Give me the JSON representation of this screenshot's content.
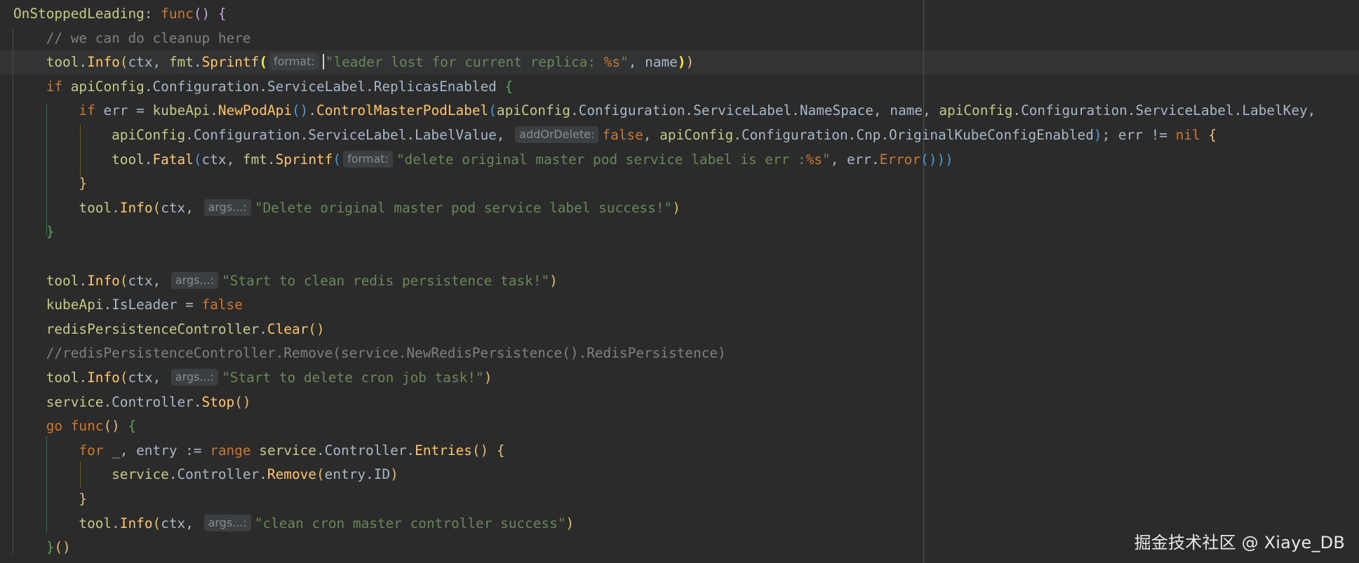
{
  "editor": {
    "lines": [
      {
        "id": "l1",
        "tokens": [
          {
            "t": "OnStoppedLeading",
            "c": "idf"
          },
          {
            "t": ": "
          },
          {
            "t": "func",
            "c": "kw"
          },
          {
            "t": "()",
            "c": "bp"
          },
          {
            "t": " "
          },
          {
            "t": "{",
            "c": "bp"
          }
        ]
      },
      {
        "id": "l2",
        "tokens": [
          {
            "t": "    "
          },
          {
            "t": "// we can do cleanup here",
            "c": "cm"
          }
        ]
      },
      {
        "id": "l3",
        "tokens": [
          {
            "t": "    "
          },
          {
            "t": "tool",
            "c": "idf"
          },
          {
            "t": "."
          },
          {
            "t": "Info",
            "c": "fn"
          },
          {
            "t": "(",
            "c": "bm"
          },
          {
            "t": "ctx, "
          },
          {
            "t": "fmt",
            "c": "idf"
          },
          {
            "t": "."
          },
          {
            "t": "Sprintf",
            "c": "fn"
          },
          {
            "t": "(",
            "c": "bmatch"
          },
          {
            "h": "format:"
          },
          {
            "caret": true
          },
          {
            "t": "\"leader lost for current replica: ",
            "c": "str"
          },
          {
            "t": "%s",
            "c": "fmt"
          },
          {
            "t": "\"",
            "c": "str"
          },
          {
            "t": ", name"
          },
          {
            "t": ")",
            "c": "bmatch"
          },
          {
            "t": ")",
            "c": "bm"
          }
        ]
      },
      {
        "id": "l4",
        "tokens": [
          {
            "t": "    "
          },
          {
            "t": "if",
            "c": "kw"
          },
          {
            "t": " "
          },
          {
            "t": "apiConfig",
            "c": "idf"
          },
          {
            "t": ".Configuration.ServiceLabel.ReplicasEnabled "
          },
          {
            "t": "{",
            "c": "bg"
          }
        ]
      },
      {
        "id": "l5",
        "tokens": [
          {
            "t": "        "
          },
          {
            "t": "if",
            "c": "kw"
          },
          {
            "t": " err = "
          },
          {
            "t": "kubeApi",
            "c": "idf"
          },
          {
            "t": "."
          },
          {
            "t": "NewPodApi",
            "c": "fn"
          },
          {
            "t": "()",
            "c": "bb"
          },
          {
            "t": "."
          },
          {
            "t": "ControlMasterPodLabel",
            "c": "fn"
          },
          {
            "t": "(",
            "c": "bb"
          },
          {
            "t": "apiConfig",
            "c": "idf"
          },
          {
            "t": ".Configuration.ServiceLabel.NameSpace, name, "
          },
          {
            "t": "apiConfig",
            "c": "idf"
          },
          {
            "t": ".Configuration.ServiceLabel.LabelKey,"
          }
        ]
      },
      {
        "id": "l6",
        "tokens": [
          {
            "t": "            "
          },
          {
            "t": "apiConfig",
            "c": "idf"
          },
          {
            "t": ".Configuration.ServiceLabel.LabelValue, "
          },
          {
            "h": "addOrDelete:"
          },
          {
            "t": "false",
            "c": "kw"
          },
          {
            "t": ", "
          },
          {
            "t": "apiConfig",
            "c": "idf"
          },
          {
            "t": ".Configuration.Cnp.OriginalKubeConfigEnabled"
          },
          {
            "t": ")",
            "c": "bb"
          },
          {
            "t": "; err != "
          },
          {
            "t": "nil",
            "c": "kw"
          },
          {
            "t": " "
          },
          {
            "t": "{",
            "c": "by"
          }
        ]
      },
      {
        "id": "l7",
        "tokens": [
          {
            "t": "            "
          },
          {
            "t": "tool",
            "c": "idf"
          },
          {
            "t": "."
          },
          {
            "t": "Fatal",
            "c": "fn"
          },
          {
            "t": "(",
            "c": "bb"
          },
          {
            "t": "ctx, "
          },
          {
            "t": "fmt",
            "c": "idf"
          },
          {
            "t": "."
          },
          {
            "t": "Sprintf",
            "c": "fn"
          },
          {
            "t": "(",
            "c": "bb"
          },
          {
            "h": "format:"
          },
          {
            "t": "\"delete original master pod service label is err :",
            "c": "str"
          },
          {
            "t": "%s",
            "c": "fmt"
          },
          {
            "t": "\"",
            "c": "str"
          },
          {
            "t": ", err."
          },
          {
            "t": "Error",
            "c": "kw"
          },
          {
            "t": "()))",
            "c": "bb"
          }
        ]
      },
      {
        "id": "l8",
        "tokens": [
          {
            "t": "        "
          },
          {
            "t": "}",
            "c": "by"
          }
        ]
      },
      {
        "id": "l9",
        "tokens": [
          {
            "t": "        "
          },
          {
            "t": "tool",
            "c": "idf"
          },
          {
            "t": "."
          },
          {
            "t": "Info",
            "c": "fn"
          },
          {
            "t": "(",
            "c": "bm"
          },
          {
            "t": "ctx, "
          },
          {
            "h": "args...:"
          },
          {
            "t": "\"Delete original master pod service label success!\"",
            "c": "str"
          },
          {
            "t": ")",
            "c": "bm"
          }
        ]
      },
      {
        "id": "l10",
        "tokens": [
          {
            "t": "    "
          },
          {
            "t": "}",
            "c": "bg"
          }
        ]
      },
      {
        "id": "l11",
        "tokens": [
          {
            "t": ""
          }
        ]
      },
      {
        "id": "l12",
        "tokens": [
          {
            "t": "    "
          },
          {
            "t": "tool",
            "c": "idf"
          },
          {
            "t": "."
          },
          {
            "t": "Info",
            "c": "fn"
          },
          {
            "t": "(",
            "c": "bm"
          },
          {
            "t": "ctx, "
          },
          {
            "h": "args...:"
          },
          {
            "t": "\"Start to clean redis persistence task!\"",
            "c": "str"
          },
          {
            "t": ")",
            "c": "bm"
          }
        ]
      },
      {
        "id": "l13",
        "tokens": [
          {
            "t": "    "
          },
          {
            "t": "kubeApi",
            "c": "idf"
          },
          {
            "t": ".IsLeader = "
          },
          {
            "t": "false",
            "c": "kw"
          }
        ]
      },
      {
        "id": "l14",
        "tokens": [
          {
            "t": "    "
          },
          {
            "t": "redisPersistenceController",
            "c": "idf"
          },
          {
            "t": "."
          },
          {
            "t": "Clear",
            "c": "fn"
          },
          {
            "t": "()",
            "c": "bm"
          }
        ]
      },
      {
        "id": "l15",
        "tokens": [
          {
            "t": "    "
          },
          {
            "t": "//redisPersistenceController.Remove(service.NewRedisPersistence().RedisPersistence)",
            "c": "cm"
          }
        ]
      },
      {
        "id": "l16",
        "tokens": [
          {
            "t": "    "
          },
          {
            "t": "tool",
            "c": "idf"
          },
          {
            "t": "."
          },
          {
            "t": "Info",
            "c": "fn"
          },
          {
            "t": "(",
            "c": "bm"
          },
          {
            "t": "ctx, "
          },
          {
            "h": "args...:"
          },
          {
            "t": "\"Start to delete cron job task!\"",
            "c": "str"
          },
          {
            "t": ")",
            "c": "bm"
          }
        ]
      },
      {
        "id": "l17",
        "tokens": [
          {
            "t": "    "
          },
          {
            "t": "service",
            "c": "idf"
          },
          {
            "t": ".Controller."
          },
          {
            "t": "Stop",
            "c": "fn"
          },
          {
            "t": "()",
            "c": "bm"
          }
        ]
      },
      {
        "id": "l18",
        "tokens": [
          {
            "t": "    "
          },
          {
            "t": "go",
            "c": "kw"
          },
          {
            "t": " "
          },
          {
            "t": "func",
            "c": "kw"
          },
          {
            "t": "()",
            "c": "bm"
          },
          {
            "t": " "
          },
          {
            "t": "{",
            "c": "bg"
          }
        ]
      },
      {
        "id": "l19",
        "tokens": [
          {
            "t": "        "
          },
          {
            "t": "for",
            "c": "kw"
          },
          {
            "t": " _, entry := "
          },
          {
            "t": "range",
            "c": "kw"
          },
          {
            "t": " "
          },
          {
            "t": "service",
            "c": "idf"
          },
          {
            "t": ".Controller."
          },
          {
            "t": "Entries",
            "c": "fn"
          },
          {
            "t": "()",
            "c": "bm"
          },
          {
            "t": " "
          },
          {
            "t": "{",
            "c": "by"
          }
        ]
      },
      {
        "id": "l20",
        "tokens": [
          {
            "t": "            "
          },
          {
            "t": "service",
            "c": "idf"
          },
          {
            "t": ".Controller."
          },
          {
            "t": "Remove",
            "c": "fn"
          },
          {
            "t": "(",
            "c": "bm"
          },
          {
            "t": "entry.ID"
          },
          {
            "t": ")",
            "c": "bm"
          }
        ]
      },
      {
        "id": "l21",
        "tokens": [
          {
            "t": "        "
          },
          {
            "t": "}",
            "c": "by"
          }
        ]
      },
      {
        "id": "l22",
        "tokens": [
          {
            "t": "        "
          },
          {
            "t": "tool",
            "c": "idf"
          },
          {
            "t": "."
          },
          {
            "t": "Info",
            "c": "fn"
          },
          {
            "t": "(",
            "c": "bm"
          },
          {
            "t": "ctx, "
          },
          {
            "h": "args...:"
          },
          {
            "t": "\"clean cron master controller success\"",
            "c": "str"
          },
          {
            "t": ")",
            "c": "bm"
          }
        ]
      },
      {
        "id": "l23",
        "tokens": [
          {
            "t": "    "
          },
          {
            "t": "}",
            "c": "bg"
          },
          {
            "t": "()",
            "c": "bm"
          }
        ]
      }
    ]
  },
  "watermark": {
    "text": "掘金技术社区 @ Xiaye_DB"
  },
  "colors": {
    "background": "#2b2b2b",
    "current_line": "#313335",
    "keyword": "#cc7832",
    "function": "#ffc66d",
    "string": "#6a8759",
    "comment": "#808080",
    "text": "#a9b7c6"
  }
}
